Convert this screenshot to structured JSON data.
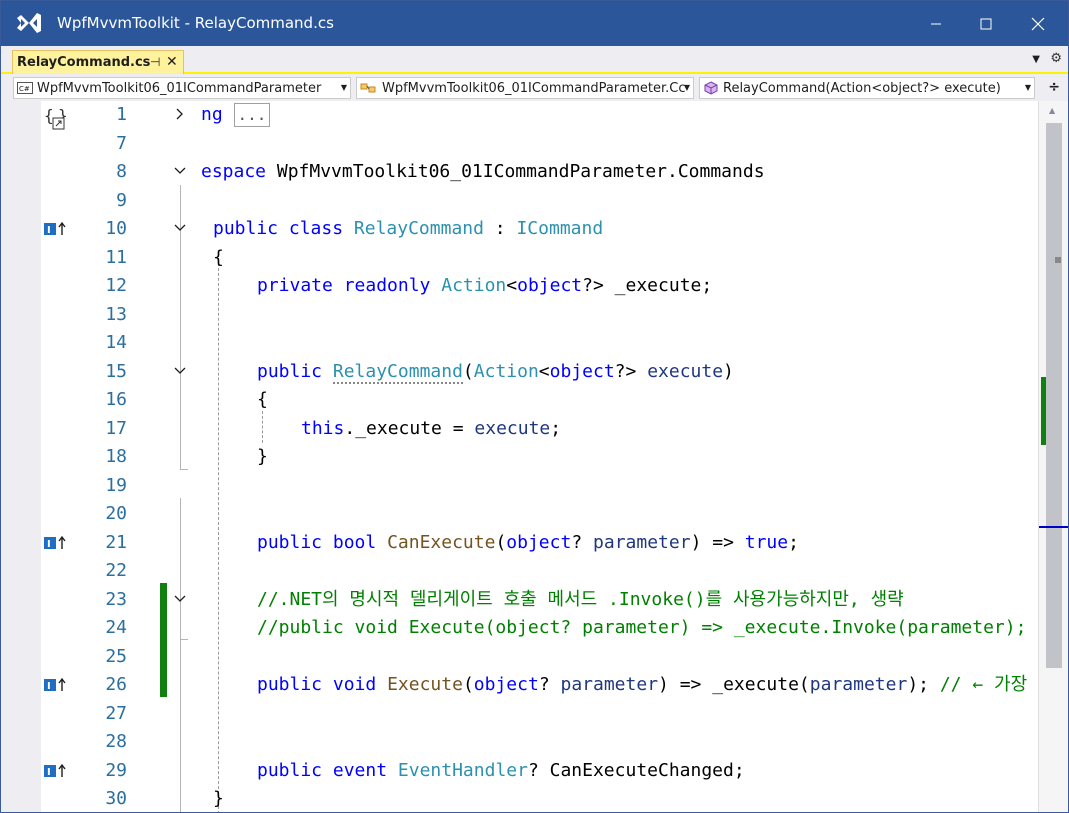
{
  "window": {
    "title": "WpfMvvmToolkit - RelayCommand.cs"
  },
  "tab": {
    "label": "RelayCommand.cs",
    "pin_glyph": "⊣",
    "close_glyph": "✕"
  },
  "navbar": {
    "project": "WpfMvvmToolkit06_01ICommandParameter",
    "type": "WpfMvvmToolkit06_01ICommandParameter.Cc",
    "member": "RelayCommand(Action<object?> execute)"
  },
  "code_lines": [
    {
      "num": "1",
      "text": "ng [...]"
    },
    {
      "num": "7",
      "text": ""
    },
    {
      "num": "8",
      "text": "espace WpfMvvmToolkit06_01ICommandParameter.Commands"
    },
    {
      "num": "9",
      "text": ""
    },
    {
      "num": "10",
      "text": "public class RelayCommand : ICommand"
    },
    {
      "num": "11",
      "text": "{"
    },
    {
      "num": "12",
      "text": "private readonly Action<object?> _execute;"
    },
    {
      "num": "13",
      "text": ""
    },
    {
      "num": "14",
      "text": ""
    },
    {
      "num": "15",
      "text": "public RelayCommand(Action<object?> execute)"
    },
    {
      "num": "16",
      "text": "{"
    },
    {
      "num": "17",
      "text": "this._execute = execute;"
    },
    {
      "num": "18",
      "text": "}"
    },
    {
      "num": "19",
      "text": ""
    },
    {
      "num": "20",
      "text": ""
    },
    {
      "num": "21",
      "text": "public bool CanExecute(object? parameter) => true;"
    },
    {
      "num": "22",
      "text": ""
    },
    {
      "num": "23",
      "text": "//.NET의 명시적 델리게이트 호출 메서드 .Invoke()를 사용가능하지만, 생략"
    },
    {
      "num": "24",
      "text": "//public void Execute(object? parameter) => _execute.Invoke(parameter);"
    },
    {
      "num": "25",
      "text": ""
    },
    {
      "num": "26",
      "text": "public void Execute(object? parameter) => _execute(parameter); // ← 가장"
    },
    {
      "num": "27",
      "text": ""
    },
    {
      "num": "28",
      "text": ""
    },
    {
      "num": "29",
      "text": "public event EventHandler? CanExecuteChanged;"
    },
    {
      "num": "30",
      "text": "}"
    }
  ],
  "tokens": {
    "l1_ng": "ng",
    "l1_collapsed": "...",
    "l8_kw": "espace",
    "l8_ns": " WpfMvvmToolkit06_01ICommandParameter.Commands",
    "l10_public": "public",
    "l10_class": "class",
    "l10_name": "RelayCommand",
    "l10_colon": " : ",
    "l10_iface": "ICommand",
    "l11": "{",
    "l12_private": "private",
    "l12_readonly": "readonly",
    "l12_action": "Action",
    "l12_lt": "<",
    "l12_object": "object",
    "l12_rest": "?> _execute;",
    "l15_public": "public",
    "l15_ctor": "RelayCommand",
    "l15_paren": "(",
    "l15_action": "Action",
    "l15_lt": "<",
    "l15_object": "object",
    "l15_q": "?> ",
    "l15_param": "execute",
    "l15_close": ")",
    "l16": "{",
    "l17_this": "this",
    "l17_mid": "._execute = ",
    "l17_param": "execute",
    "l17_end": ";",
    "l18": "}",
    "l21_public": "public",
    "l21_bool": "bool",
    "l21_method": "CanExecute",
    "l21_paren": "(",
    "l21_object": "object",
    "l21_q": "? ",
    "l21_param": "parameter",
    "l21_arrow": ") => ",
    "l21_true": "true",
    "l21_end": ";",
    "l23_comment": "//.NET의 명시적 델리게이트 호출 메서드 .Invoke()를 사용가능하지만, 생략",
    "l24_comment": "//public void Execute(object? parameter) => _execute.Invoke(parameter);",
    "l26_public": "public",
    "l26_void": "void",
    "l26_method": "Execute",
    "l26_paren": "(",
    "l26_object": "object",
    "l26_q": "? ",
    "l26_param": "parameter",
    "l26_arrow": ") => _execute(",
    "l26_param2": "parameter",
    "l26_end": "); ",
    "l26_comment": "// ← 가장",
    "l29_public": "public",
    "l29_event": "event",
    "l29_type": "EventHandler",
    "l29_rest": "? CanExecuteChanged;",
    "l30": "}"
  },
  "colors": {
    "titlebar": "#2b579a",
    "active_tab": "#fff29d",
    "keyword": "#0000ff",
    "type": "#2b91af",
    "method": "#74531f",
    "parameter": "#1f377f",
    "comment": "#008000",
    "line_number": "#2b6fa0",
    "change_marker": "#108010"
  }
}
